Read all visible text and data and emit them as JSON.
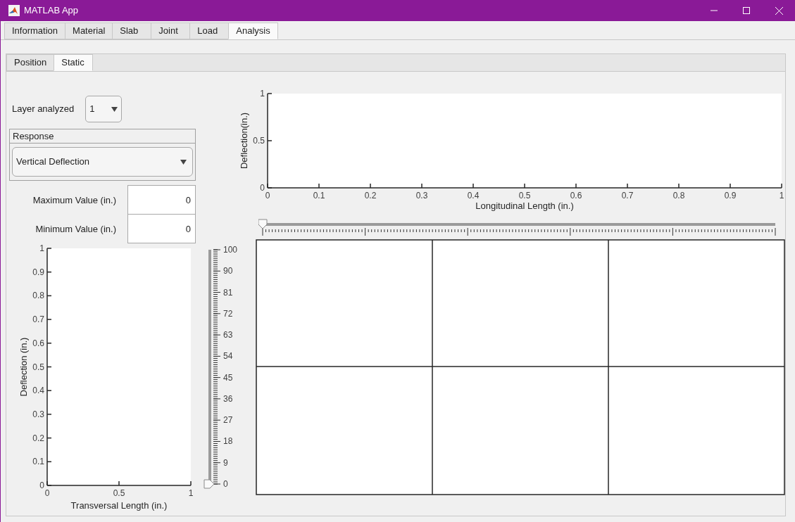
{
  "window": {
    "title": "MATLAB App"
  },
  "tabs": [
    {
      "label": "Information",
      "selected": false
    },
    {
      "label": "Material",
      "selected": false
    },
    {
      "label": "Slab",
      "selected": false
    },
    {
      "label": "Joint",
      "selected": false
    },
    {
      "label": "Load",
      "selected": false
    },
    {
      "label": "Analysis",
      "selected": true
    }
  ],
  "subtabs": [
    {
      "label": "Position",
      "selected": false
    },
    {
      "label": "Static",
      "selected": true
    }
  ],
  "layer": {
    "label": "Layer analyzed",
    "value": "1"
  },
  "response": {
    "title": "Response",
    "value": "Vertical Deflection"
  },
  "fields": [
    {
      "label": "Maximum Value (in.)",
      "value": "0"
    },
    {
      "label": "Minimum Value (in.)",
      "value": "0"
    }
  ],
  "longitudinal_chart": {
    "chart_data": {
      "type": "line",
      "xlabel": "Longitudinal Length (in.)",
      "ylabel": "Deflection(in.)",
      "xlim": [
        0,
        1
      ],
      "ylim": [
        0,
        1
      ],
      "xticks": [
        0,
        0.1,
        0.2,
        0.3,
        0.4,
        0.5,
        0.6,
        0.7,
        0.8,
        0.9,
        1
      ],
      "yticks": [
        0,
        0.5,
        1
      ]
    }
  },
  "length_slider": {
    "level": 0
  },
  "transversal_chart": {
    "chart_data": {
      "type": "line",
      "xlabel": "Transversal Length (in.)",
      "ylabel": "Deflection (in.)",
      "xlim": [
        0,
        1
      ],
      "ylim": [
        0,
        1
      ],
      "xticks": [
        0,
        0.5,
        1
      ],
      "yticks": [
        0,
        0.1,
        0.2,
        0.3,
        0.4,
        0.5,
        0.6,
        0.7,
        0.8,
        0.9,
        1
      ]
    }
  },
  "position_slider": {
    "level": 0,
    "labels": [
      "100",
      "90",
      "81",
      "72",
      "63",
      "54",
      "45",
      "36",
      "27",
      "18",
      "9",
      "0"
    ]
  }
}
